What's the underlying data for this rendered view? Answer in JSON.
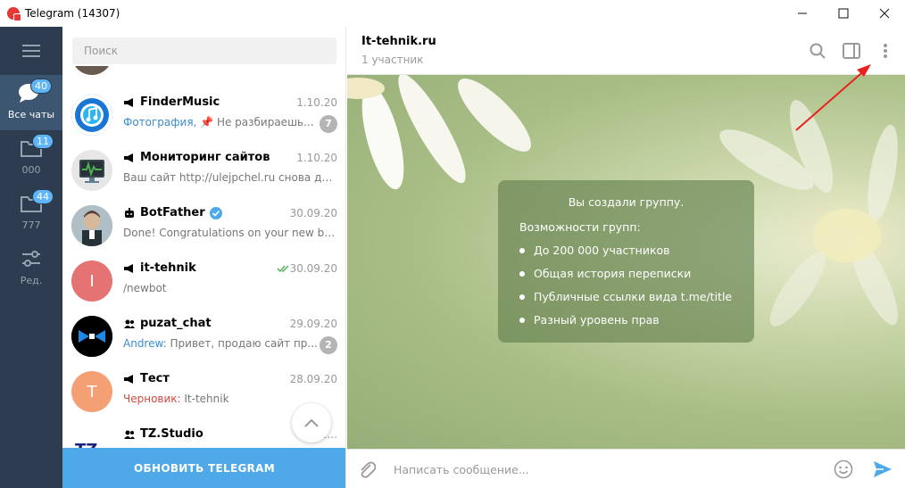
{
  "window": {
    "title": "Telegram (14307)",
    "minimize": "—",
    "maximize": "☐",
    "close": "✕"
  },
  "folders": [
    {
      "label": "Все чаты",
      "badge": "40",
      "icon": "chats-icon",
      "active": true
    },
    {
      "label": "000",
      "badge": "11",
      "icon": "folder-icon",
      "active": false
    },
    {
      "label": "777",
      "badge": "44",
      "icon": "folder-icon",
      "active": false
    },
    {
      "label": "Ред.",
      "badge": "",
      "icon": "edit-filters-icon",
      "active": false
    }
  ],
  "search": {
    "placeholder": "Поиск"
  },
  "chats": [
    {
      "name": "FinderMusic",
      "type": "channel",
      "date": "1.10.20",
      "preview_highlight": "Фотография, ",
      "preview": "📌 Не разбираешь...",
      "unread": "7"
    },
    {
      "name": "Мониторинг сайтов",
      "type": "channel",
      "date": "1.10.20",
      "preview_highlight": "",
      "preview": "Ваш сайт http://ulejpchel.ru снова дос...",
      "unread": ""
    },
    {
      "name": "BotFather",
      "type": "bot",
      "date": "30.09.20",
      "preview_highlight": "",
      "preview": "Done! Congratulations on your new bo...",
      "unread": ""
    },
    {
      "name": "it-tehnik",
      "type": "channel",
      "date": "30.09.20",
      "preview_highlight": "",
      "preview": "/newbot",
      "unread": "",
      "avatar_letter": "I"
    },
    {
      "name": "puzat_chat",
      "type": "group",
      "date": "29.09.20",
      "preview_highlight": "Andrew: ",
      "preview": "Привет, продаю сайт пр...",
      "unread": "2"
    },
    {
      "name": "Тест",
      "type": "channel",
      "date": "28.09.20",
      "preview_draft": "Черновик: ",
      "preview": "It-tehnik",
      "unread": "",
      "avatar_letter": "T"
    },
    {
      "name": "TZ.Studio",
      "type": "group",
      "date": "2...",
      "preview_highlight": "",
      "preview": "",
      "unread": ""
    }
  ],
  "update_button": "ОБНОВИТЬ TELEGRAM",
  "chat": {
    "title": "It-tehnik.ru",
    "subtitle": "1 участник",
    "info_title": "Вы создали группу.",
    "info_subtitle": "Возможности групп:",
    "features": [
      "До 200 000 участников",
      "Общая история переписки",
      "Публичные ссылки вида t.me/title",
      "Разный уровень прав"
    ]
  },
  "composer": {
    "placeholder": "Написать сообщение..."
  },
  "colors": {
    "sidebar": "#2d3c4e",
    "sidebar_active": "#3c5570",
    "accent": "#4fa8e8",
    "badge": "#5eb5f7",
    "arrow": "#e8231f"
  }
}
